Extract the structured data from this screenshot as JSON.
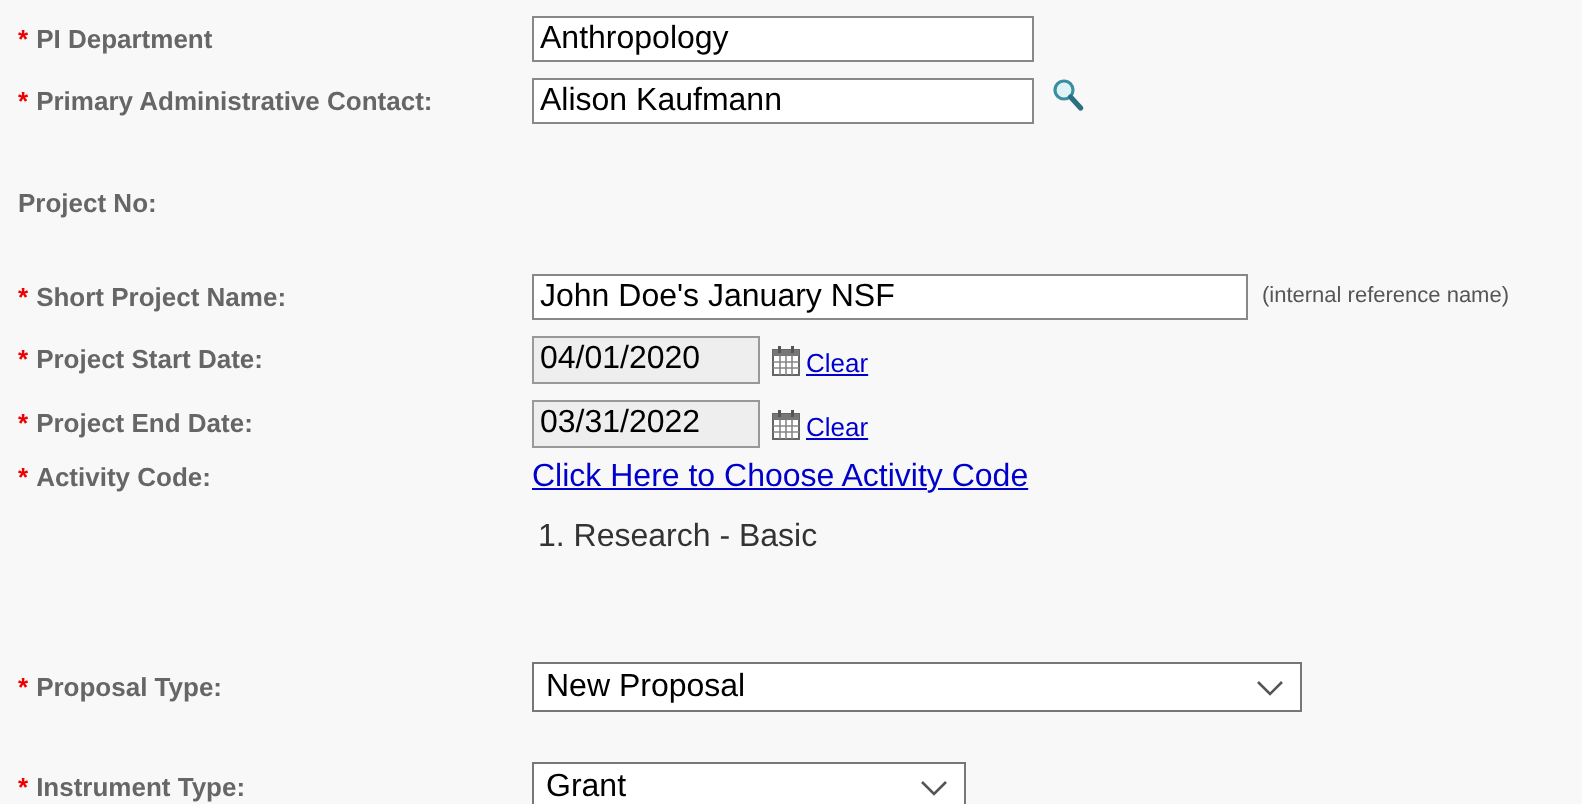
{
  "fields": [
    {
      "kind": "text",
      "marker": "*",
      "label": "PI Department",
      "value": "Anthropology"
    },
    {
      "kind": "search",
      "marker": "*",
      "label": "Primary Administrative Contact:",
      "value": "Alison Kaufmann"
    },
    {
      "kind": "none",
      "label": "Project No:"
    },
    {
      "kind": "hint",
      "marker": "*",
      "label": "Short Project Name:",
      "value": "John Doe's January NSF",
      "hint": "(internal reference name)"
    },
    {
      "kind": "date",
      "marker": "*",
      "label": "Project Start Date:",
      "value": "04/01/2020",
      "action": "Clear"
    },
    {
      "kind": "date",
      "marker": "*",
      "label": "Project End Date:",
      "value": "03/31/2022",
      "action": "Clear"
    },
    {
      "kind": "link",
      "marker": "*",
      "label": "Activity Code:",
      "link": "Click Here to Choose Activity Code"
    },
    {
      "kind": "note",
      "text": "1. Research - Basic"
    },
    {
      "kind": "select",
      "marker": "*",
      "label": "Proposal Type:",
      "value": "New Proposal"
    },
    {
      "kind": "select",
      "marker": "*",
      "label": "Instrument Type:",
      "value": "Grant"
    }
  ]
}
